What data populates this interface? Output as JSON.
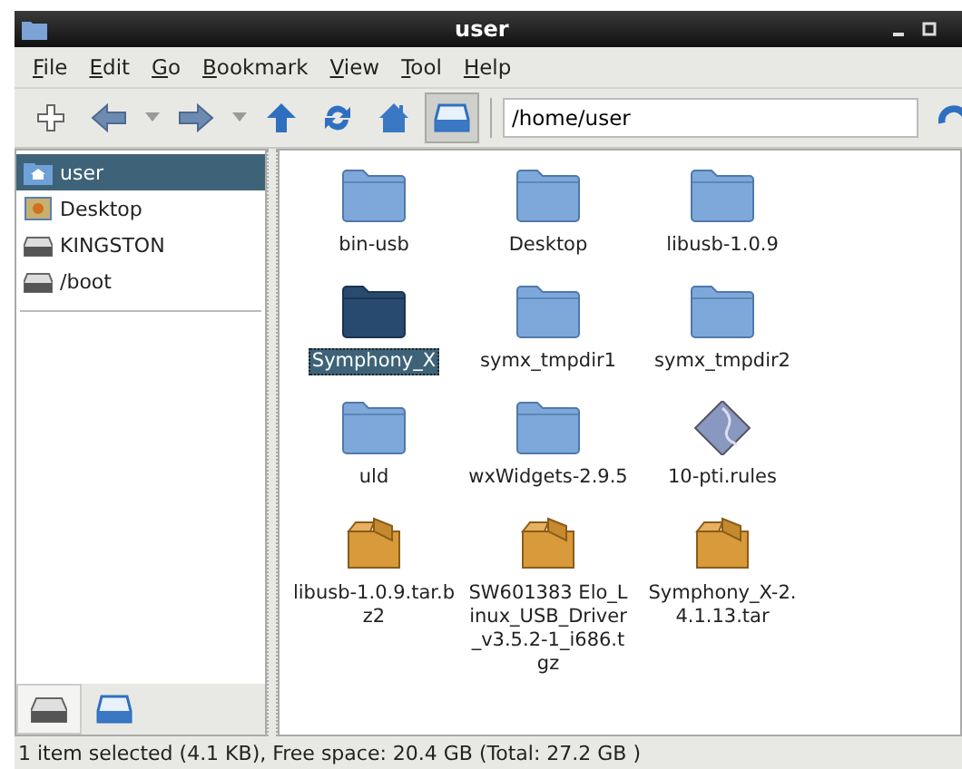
{
  "window": {
    "title": "user"
  },
  "menu": [
    "File",
    "Edit",
    "Go",
    "Bookmark",
    "View",
    "Tool",
    "Help"
  ],
  "toolbar": [
    {
      "kind": "add",
      "on": false
    },
    {
      "kind": "back",
      "on": false
    },
    {
      "kind": "dropdown",
      "on": false
    },
    {
      "kind": "forward",
      "on": false
    },
    {
      "kind": "dropdown",
      "on": false
    },
    {
      "kind": "up",
      "on": false
    },
    {
      "kind": "refresh",
      "on": false
    },
    {
      "kind": "home",
      "on": false
    },
    {
      "kind": "sidebar",
      "on": true
    }
  ],
  "location": {
    "value": "/home/user"
  },
  "sidebar": {
    "items": [
      {
        "label": "user",
        "kind": "home",
        "selected": true
      },
      {
        "label": "Desktop",
        "kind": "desktop",
        "selected": false
      },
      {
        "label": "KINGSTON",
        "kind": "drive",
        "selected": false
      },
      {
        "label": "/boot",
        "kind": "drive",
        "selected": false
      }
    ],
    "tabs": [
      {
        "kind": "places",
        "selected": true
      },
      {
        "kind": "tree",
        "selected": false
      }
    ]
  },
  "files": [
    {
      "name": "bin-usb",
      "kind": "folder",
      "selected": false
    },
    {
      "name": "Desktop",
      "kind": "folder",
      "selected": false
    },
    {
      "name": "libusb-1.0.9",
      "kind": "folder",
      "selected": false
    },
    {
      "name": "Symphony_X",
      "kind": "folder",
      "selected": true
    },
    {
      "name": "symx_tmpdir1",
      "kind": "folder",
      "selected": false
    },
    {
      "name": "symx_tmpdir2",
      "kind": "folder",
      "selected": false
    },
    {
      "name": "uld",
      "kind": "folder",
      "selected": false
    },
    {
      "name": "wxWidgets-2.9.5",
      "kind": "folder",
      "selected": false
    },
    {
      "name": "10-pti.rules",
      "kind": "rules",
      "selected": false
    },
    {
      "name": "libusb-1.0.9.tar.bz2",
      "kind": "archive",
      "selected": false
    },
    {
      "name": "SW601383 Elo_Linux_USB_Driver_v3.5.2-1_i686.tgz",
      "kind": "archive",
      "selected": false
    },
    {
      "name": "Symphony_X-2.4.1.13.tar",
      "kind": "archive",
      "selected": false
    }
  ],
  "status_bar": "1 item selected (4.1 KB), Free space: 20.4 GB (Total: 27.2 GB )"
}
